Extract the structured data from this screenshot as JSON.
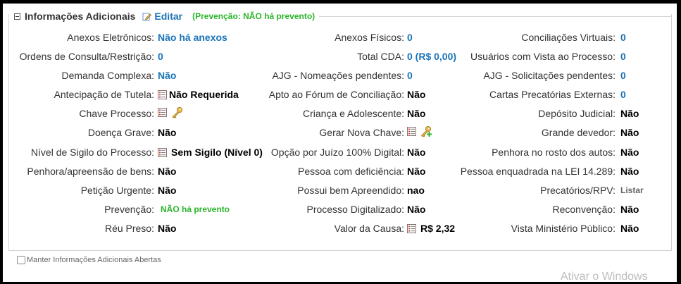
{
  "section": {
    "title": "Informações Adicionais",
    "edit_label": "Editar",
    "prevention_note": "(Prevenção:  NÃO há prevento)"
  },
  "rows": [
    {
      "c1_label": "Anexos Eletrônicos:",
      "c1_value": "Não há anexos",
      "c2_label": "Anexos Físicos:",
      "c2_value": "0",
      "c3_label": "Conciliações Virtuais:",
      "c3_value": "0"
    },
    {
      "c1_label": "Ordens de Consulta/Restrição:",
      "c1_value": "0",
      "c2_label": "Total CDA:",
      "c2_value": "0 (R$ 0,00)",
      "c3_label": "Usuários com Vista ao Processo:",
      "c3_value": "0"
    },
    {
      "c1_label": "Demanda Complexa:",
      "c1_value": "Não",
      "c2_label": "AJG - Nomeações pendentes:",
      "c2_value": "0",
      "c3_label": "AJG - Solicitações pendentes:",
      "c3_value": "0"
    },
    {
      "c1_label": "Antecipação de Tutela:",
      "c1_value": "Não Requerida",
      "c2_label": "Apto ao Fórum de Conciliação:",
      "c2_value": "Não",
      "c3_label": "Cartas Precatórias Externas:",
      "c3_value": "0"
    },
    {
      "c1_label": "Chave Processo:",
      "c1_value": "",
      "c2_label": "Criança e Adolescente:",
      "c2_value": "Não",
      "c3_label": "Depósito Judicial:",
      "c3_value": "Não"
    },
    {
      "c1_label": "Doença Grave:",
      "c1_value": "Não",
      "c2_label": "Gerar Nova Chave:",
      "c2_value": "",
      "c3_label": "Grande devedor:",
      "c3_value": "Não"
    },
    {
      "c1_label": "Nível de Sigilo do Processo:",
      "c1_value": "Sem Sigilo (Nível 0)",
      "c2_label": "Opção por Juízo 100% Digital:",
      "c2_value": "Não",
      "c3_label": "Penhora no rosto dos autos:",
      "c3_value": "Não"
    },
    {
      "c1_label": "Penhora/apreensão de bens:",
      "c1_value": "Não",
      "c2_label": "Pessoa com deficiência:",
      "c2_value": "Não",
      "c3_label": "Pessoa enquadrada na LEI 14.289:",
      "c3_value": "Não"
    },
    {
      "c1_label": "Petição Urgente:",
      "c1_value": "Não",
      "c2_label": "Possui bem Apreendido:",
      "c2_value": "nao",
      "c3_label": "Precatórios/RPV:",
      "c3_value": "Listar"
    },
    {
      "c1_label": "Prevenção:",
      "c1_value": "NÃO há prevento",
      "c2_label": "Processo Digitalizado:",
      "c2_value": "Não",
      "c3_label": "Reconvenção:",
      "c3_value": "Não"
    },
    {
      "c1_label": "Réu Preso:",
      "c1_value": "Não",
      "c2_label": "Valor da Causa:",
      "c2_value": "R$ 2,32",
      "c3_label": "Vista Ministério Público:",
      "c3_value": "Não"
    }
  ],
  "footer": {
    "checkbox_label": "Manter Informações Adicionais Abertas"
  },
  "watermark": "Ativar o Windows",
  "icons": {
    "collapse": "minus-box-icon",
    "edit": "pencil-edit-icon",
    "doc": "document-list-icon",
    "key": "key-icon",
    "key_add": "key-add-icon"
  },
  "colors": {
    "link_blue": "#1a73b8",
    "green": "#2ab52a",
    "label": "#333333"
  }
}
